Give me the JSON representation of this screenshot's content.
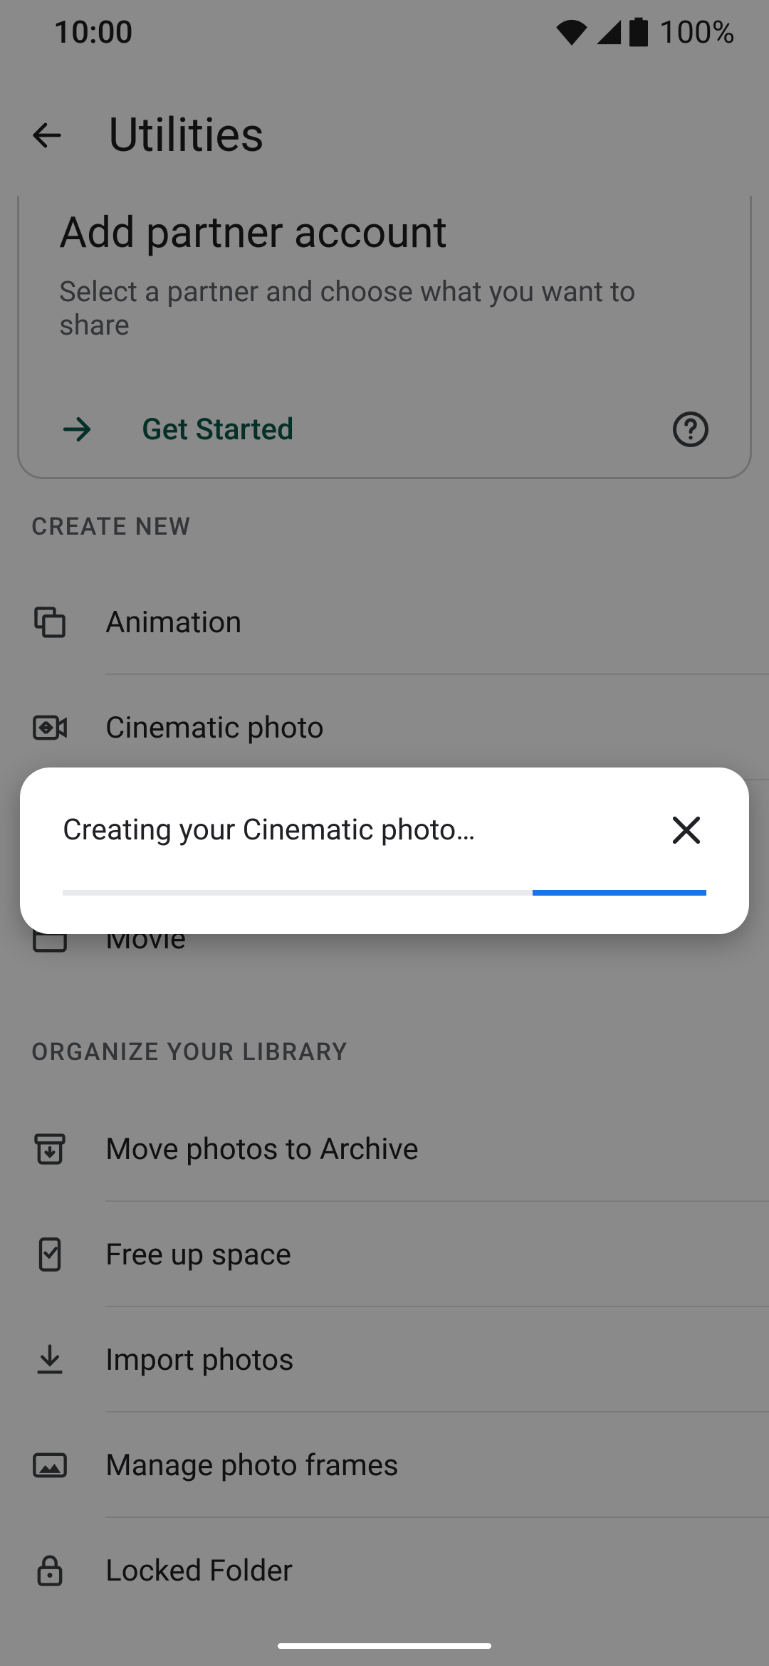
{
  "status": {
    "time": "10:00",
    "battery_pct": "100%"
  },
  "appbar": {
    "title": "Utilities"
  },
  "partner": {
    "title": "Add partner account",
    "subtitle": "Select a partner and choose what you want to share",
    "cta": "Get Started"
  },
  "sections": {
    "create_label": "CREATE NEW",
    "organize_label": "ORGANIZE YOUR LIBRARY"
  },
  "create": [
    {
      "label": "Animation"
    },
    {
      "label": "Cinematic photo"
    },
    {
      "label": ""
    },
    {
      "label": "Movie"
    }
  ],
  "organize": [
    {
      "label": "Move photos to Archive"
    },
    {
      "label": "Free up space"
    },
    {
      "label": "Import photos"
    },
    {
      "label": "Manage photo frames"
    },
    {
      "label": "Locked Folder"
    }
  ],
  "dialog": {
    "title": "Creating your Cinematic photo…",
    "progress": {
      "left_pct": 73,
      "width_pct": 27
    }
  },
  "colors": {
    "accent": "#1a73e8",
    "teal": "#0b5a4a"
  }
}
